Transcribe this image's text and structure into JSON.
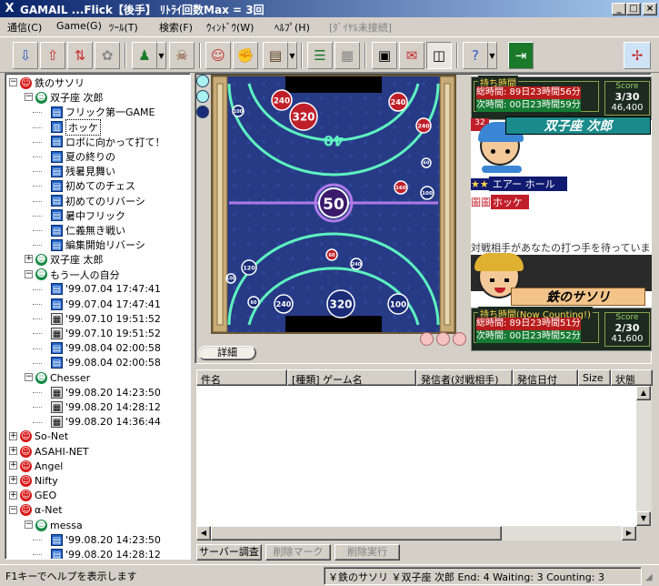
{
  "window": {
    "title": "GAMAIL  ...Flick【後手】 ﾘﾄﾗｲ回数Max = 3回",
    "app_icon": "X",
    "min": "_",
    "max": "□",
    "close": "×"
  },
  "menus": [
    "通信(C)",
    "Game(G)",
    "ﾂｰﾙ(T)",
    "検索(F)",
    "ｳｨﾝﾄﾞｳ(W)",
    "ﾍﾙﾌﾟ(H)",
    "[ﾀﾞｲﾔﾙ未接続]"
  ],
  "toolbar": {
    "buttons": [
      {
        "name": "receive-mail-icon",
        "glyph": "⇩"
      },
      {
        "name": "send-mail-icon",
        "glyph": "⇧"
      },
      {
        "name": "send-receive-icon",
        "glyph": "⇅"
      },
      {
        "name": "puzzle-icon",
        "glyph": "✿"
      },
      {
        "name": "game-table-icon",
        "glyph": "♟"
      },
      {
        "name": "resign-icon",
        "glyph": "☠"
      },
      {
        "name": "players-icon",
        "glyph": "☺"
      },
      {
        "name": "fist-icon",
        "glyph": "✊"
      },
      {
        "name": "book-icon",
        "glyph": "▤"
      },
      {
        "name": "list-icon",
        "glyph": "☰"
      },
      {
        "name": "grid-icon",
        "glyph": "▦"
      },
      {
        "name": "document-icon",
        "glyph": "▣"
      },
      {
        "name": "chat-icon",
        "glyph": "✉"
      },
      {
        "name": "tile-icon",
        "glyph": "◫"
      },
      {
        "name": "help-icon",
        "glyph": "?"
      },
      {
        "name": "exit-door-icon",
        "glyph": "⇥"
      },
      {
        "name": "windmill-logo-icon",
        "glyph": "✢"
      }
    ]
  },
  "tree": [
    {
      "label": "鉄のサソリ",
      "icon": "face",
      "depth": 0
    },
    {
      "label": "双子座 次郎",
      "icon": "cap",
      "depth": 1
    },
    {
      "label": "フリック第一GAME",
      "icon": "doc",
      "depth": 2
    },
    {
      "label": "ホッケ",
      "icon": "book",
      "depth": 2,
      "selected": true
    },
    {
      "label": "ロボに向かって打て！",
      "icon": "doc",
      "depth": 2
    },
    {
      "label": "夏の終りの",
      "icon": "doc",
      "depth": 2
    },
    {
      "label": "残暑見舞い",
      "icon": "doc",
      "depth": 2
    },
    {
      "label": "初めてのチェス",
      "icon": "doc",
      "depth": 2
    },
    {
      "label": "初めてのリバーシ",
      "icon": "doc",
      "depth": 2
    },
    {
      "label": "暑中フリック",
      "icon": "doc",
      "depth": 2
    },
    {
      "label": "仁義無き戦い",
      "icon": "doc",
      "depth": 2
    },
    {
      "label": "編集開始リバーシ",
      "icon": "doc",
      "depth": 2
    },
    {
      "label": "双子座 太郎",
      "icon": "cap",
      "depth": 1
    },
    {
      "label": "もう一人の自分",
      "icon": "cap",
      "depth": 1
    },
    {
      "label": "'99.07.04 17:47:41",
      "icon": "doc",
      "depth": 2
    },
    {
      "label": "'99.07.04 17:47:41",
      "icon": "doc",
      "depth": 2
    },
    {
      "label": "'99.07.10 19:51:52",
      "icon": "chk",
      "depth": 2
    },
    {
      "label": "'99.07.10 19:51:52",
      "icon": "chk",
      "depth": 2
    },
    {
      "label": "'99.08.04 02:00:58",
      "icon": "doc",
      "depth": 2
    },
    {
      "label": "'99.08.04 02:00:58",
      "icon": "doc",
      "depth": 2
    },
    {
      "label": "Chesser",
      "icon": "cap",
      "depth": 1
    },
    {
      "label": "'99.08.20 14:23:50",
      "icon": "chk",
      "depth": 2
    },
    {
      "label": "'99.08.20 14:28:12",
      "icon": "chk",
      "depth": 2
    },
    {
      "label": "'99.08.20 14:36:44",
      "icon": "chk",
      "depth": 2
    },
    {
      "label": "So-Net",
      "icon": "face",
      "depth": 0
    },
    {
      "label": "ASAHI-NET",
      "icon": "face",
      "depth": 0
    },
    {
      "label": "Angel",
      "icon": "face",
      "depth": 0
    },
    {
      "label": "Nifty",
      "icon": "face",
      "depth": 0
    },
    {
      "label": "GEO",
      "icon": "face",
      "depth": 0
    },
    {
      "label": "α-Net",
      "icon": "face",
      "depth": 0
    },
    {
      "label": "messa",
      "icon": "cap",
      "depth": 1
    },
    {
      "label": "'99.08.20 14:23:50",
      "icon": "doc",
      "depth": 2
    },
    {
      "label": "'99.08.20 14:28:12",
      "icon": "doc",
      "depth": 2
    }
  ],
  "board": {
    "center_value": "50",
    "top_center": "40",
    "pucks": [
      "240",
      "320",
      "100",
      "240",
      "240",
      "160",
      "60",
      "100",
      "60",
      "120",
      "60",
      "240",
      "320",
      "100",
      "240",
      "100"
    ],
    "detail_button": "詳細",
    "turn_markers": 3
  },
  "top_player": {
    "header": "持ち時間",
    "total": "総時間: 89日23時間56分",
    "next": "次時間: 00日23時間59分",
    "score_label": "Score",
    "score": "3/30",
    "points": "46,400",
    "name": "双子座 次郎",
    "rank_stars": "★★",
    "rank": "エアー ホール",
    "game_tag": "圖圖",
    "game": "ホッケ",
    "badge": "32"
  },
  "status_msg": "対戦相手があなたの打つ手を待っています",
  "bottom_player": {
    "name": "鉄のサソリ",
    "header": "持ち時間(Now Counting!)",
    "total": "総時間: 89日23時間51分",
    "next": "次時間: 00日23時間52分",
    "score_label": "Score",
    "score": "2/30",
    "points": "41,600"
  },
  "list": {
    "columns": [
      "件名",
      "[種類] ゲーム名",
      "発信者(対戦相手)",
      "発信日付",
      "Size",
      "状態"
    ]
  },
  "buttons": {
    "server": "サーバー調査",
    "delete_mark": "削除マーク",
    "delete_exec": "削除実行"
  },
  "status": {
    "help": "F1キーでヘルプを表示します",
    "info": "￥鉄のサソリ ￥双子座 次郎   End: 4   Waiting: 3   Counting: 3"
  },
  "colors": {
    "title_start": "#0a246a",
    "title_end": "#a6caf0",
    "board_bg": "#243276",
    "neon": "#5ef2c0",
    "puck_red": "#c01f2a",
    "puck_blue": "#1a2c78"
  }
}
